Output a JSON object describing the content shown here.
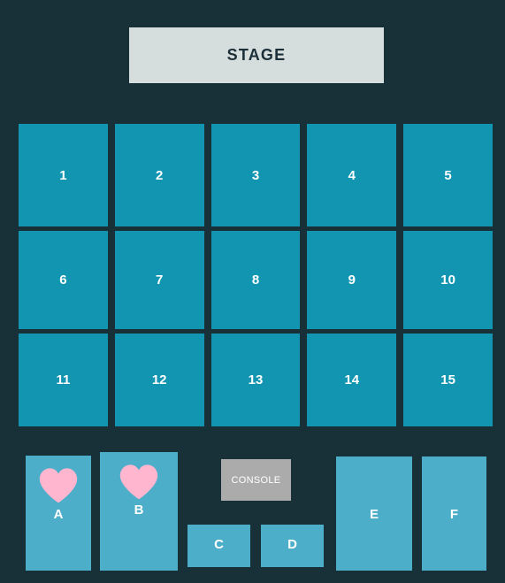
{
  "colors": {
    "background": "#183037",
    "stage_fill": "#D6DDDD",
    "stage_text": "#1B2F38",
    "seat_fill": "#1295B0",
    "section_fill": "#4DAECA",
    "console_fill": "#ABABAB",
    "heart_fill": "#FFB6CE",
    "label_text": "#FFFFFF"
  },
  "stage": {
    "label": "STAGE"
  },
  "seat_grid": {
    "rows": [
      {
        "seats": [
          {
            "label": "1"
          },
          {
            "label": "2"
          },
          {
            "label": "3"
          },
          {
            "label": "4"
          },
          {
            "label": "5"
          }
        ]
      },
      {
        "seats": [
          {
            "label": "6"
          },
          {
            "label": "7"
          },
          {
            "label": "8"
          },
          {
            "label": "9"
          },
          {
            "label": "10"
          }
        ]
      },
      {
        "seats": [
          {
            "label": "11"
          },
          {
            "label": "12"
          },
          {
            "label": "13"
          },
          {
            "label": "14"
          },
          {
            "label": "15"
          }
        ]
      }
    ]
  },
  "sections": [
    {
      "label": "A",
      "icon": "heart-icon",
      "has_heart": true
    },
    {
      "label": "B",
      "icon": "heart-icon",
      "has_heart": true
    },
    {
      "label": "C",
      "has_heart": false
    },
    {
      "label": "D",
      "has_heart": false
    },
    {
      "label": "E",
      "has_heart": false
    },
    {
      "label": "F",
      "has_heart": false
    }
  ],
  "console": {
    "label": "CONSOLE"
  }
}
